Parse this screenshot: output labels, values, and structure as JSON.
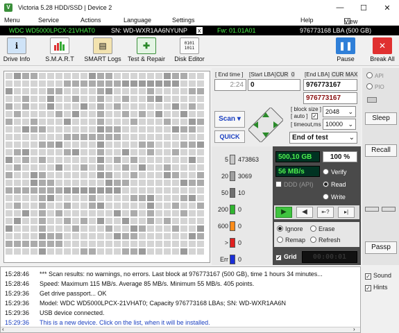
{
  "title": {
    "text": "Victoria 5.28 HDD/SSD | Device 2",
    "icon": "V",
    "min": "—",
    "max": "☐",
    "close": "✕"
  },
  "menu": [
    "Menu",
    "Service",
    "Actions",
    "Language",
    "Settings",
    "Help"
  ],
  "menu_extra": "View Buffer Live",
  "drive": {
    "model": "WDC WD5000LPCX-21VHAT0",
    "sn": "SN: WD-WXR1AA6NYUNP",
    "x": "x",
    "fw": "Fw: 01.01A01",
    "lba": "976773168 LBA (500 GB)"
  },
  "toolbar": {
    "items": [
      "Drive Info",
      "S.M.A.R.T",
      "SMART Logs",
      "Test & Repair",
      "Disk Editor"
    ],
    "pause": "Pause",
    "break_all": "Break All"
  },
  "scan": {
    "end_time_label": "[ End time ]",
    "end_time": "2:24",
    "start_lba_label": "[Start LBA]",
    "cur": "CUR",
    "zero": "0",
    "start_lba": "0",
    "end_lba_label": "[End LBA]",
    "max": "MAX",
    "end_lba": "976773167",
    "end_lba2": "976773167",
    "scan_btn": "Scan",
    "scan_arrow": "▾",
    "quick_btn": "QUICK",
    "block_size_label": "[ block size ]",
    "auto_label": "[ auto ]",
    "block_size": "2048",
    "timeout_label": "[ timeout,ms ]",
    "timeout": "10000",
    "end_of_test": "End of test"
  },
  "stats": {
    "rows": [
      {
        "label": "5",
        "value": "473863",
        "color": "#c8c8c8"
      },
      {
        "label": "20",
        "value": "3069",
        "color": "#a0a0a0"
      },
      {
        "label": "50",
        "value": "10",
        "color": "#707070"
      },
      {
        "label": "200",
        "value": "0",
        "color": "#2fb52f"
      },
      {
        "label": "600",
        "value": "0",
        "color": "#ff8c1a"
      },
      {
        "label": ">",
        "value": "0",
        "color": "#e02020"
      },
      {
        "label": "Err",
        "value": "0",
        "color": "#1a2fd8"
      }
    ],
    "processed": "500,10 GB",
    "percent": "100",
    "percent_sign": "%",
    "speed": "56 MB/s",
    "ddd_label": "DDD (API)",
    "verify": "Verify",
    "read": "Read",
    "write": "Write",
    "ignore": "Ignore",
    "erase": "Erase",
    "remap": "Remap",
    "refresh": "Refresh",
    "grid": "Grid",
    "timer": "00:00:01"
  },
  "right": {
    "api": "API",
    "pio": "PIO",
    "sleep": "Sleep",
    "recall": "Recall",
    "passp": "Passp"
  },
  "log": [
    {
      "time": "15:28:46",
      "text": "*** Scan results: no warnings, no errors. Last block at 976773167 (500 GB), time 1 hours 34 minutes...",
      "color": "#111"
    },
    {
      "time": "15:28:46",
      "text": "Speed: Maximum 115 MB/s. Average 85 MB/s. Minimum 55 MB/s. 405 points.",
      "color": "#111"
    },
    {
      "time": "15:29:36",
      "text": "Get drive passport... OK",
      "color": "#111"
    },
    {
      "time": "15:29:36",
      "text": "Model: WDC WD5000LPCX-21VHAT0; Capacity 976773168 LBAs; SN: WD-WXR1AA6N",
      "color": "#111"
    },
    {
      "time": "15:29:36",
      "text": "USB device connected.",
      "color": "#111"
    },
    {
      "time": "15:29:36",
      "text": "This is a new device. Click on the list, when it will be installed.",
      "color": "#1a3fc0"
    }
  ],
  "log_ctl": {
    "sound": "Sound",
    "hints": "Hints"
  }
}
